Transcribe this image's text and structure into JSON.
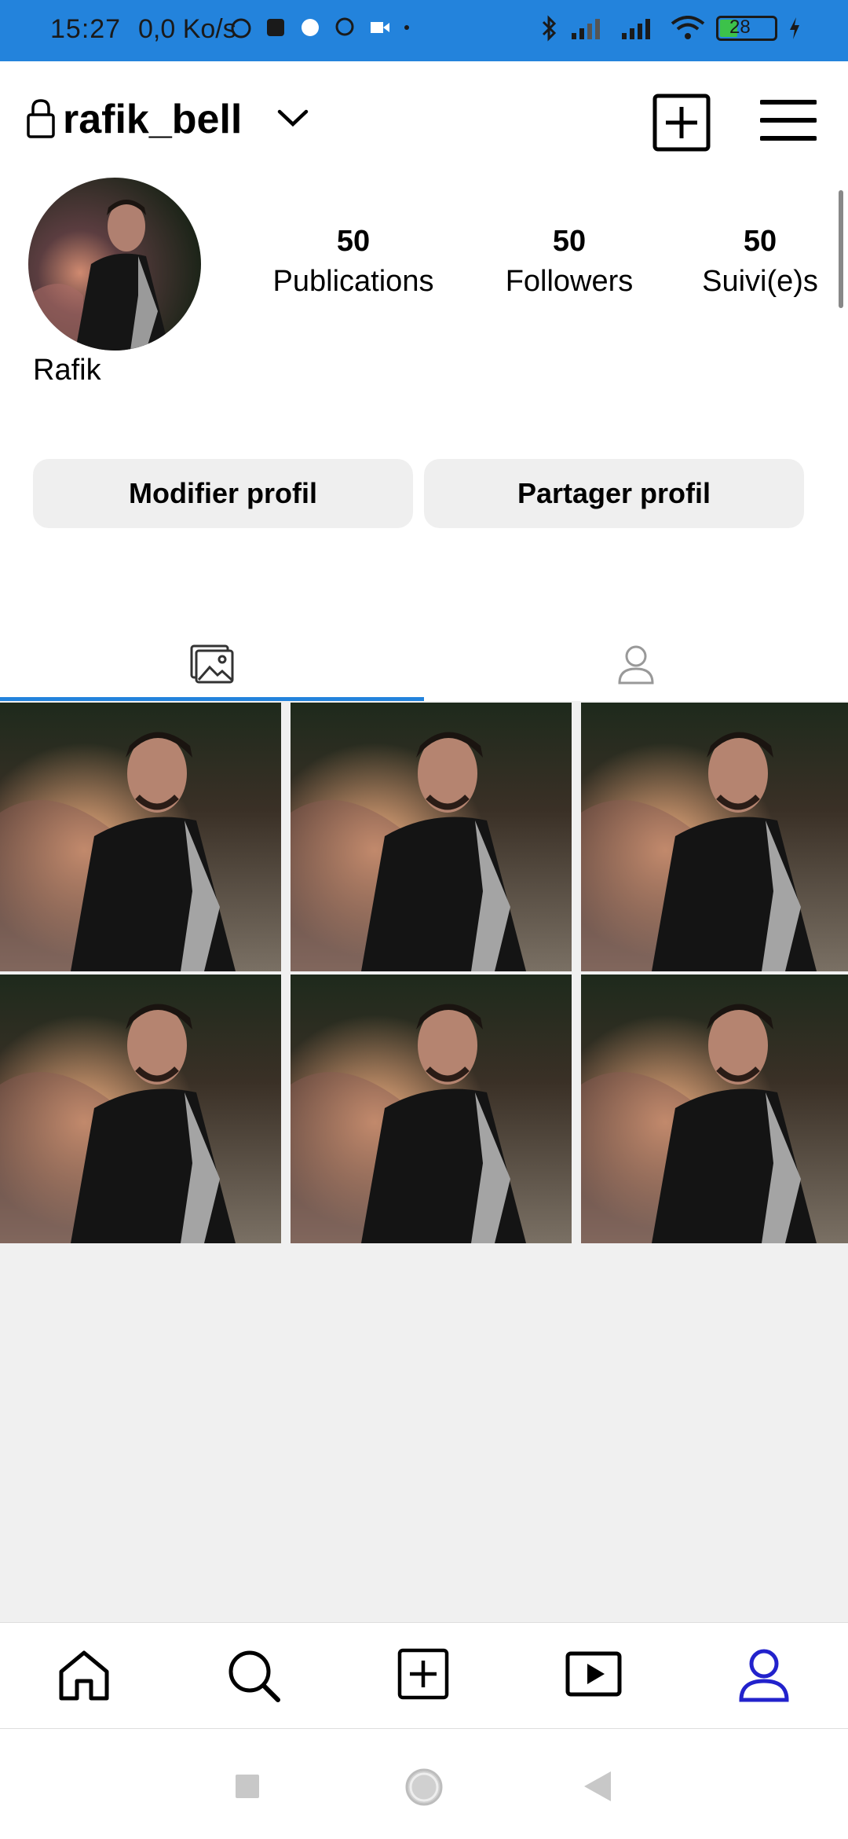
{
  "status_bar": {
    "time": "15:27",
    "net_speed": "0,0 Ko/s",
    "battery_level": "28",
    "accent_color": "#2383dc"
  },
  "header": {
    "username": "rafik_bell",
    "icons": [
      "lock-icon",
      "chevron-down-icon",
      "new-post-icon",
      "hamburger-menu-icon"
    ]
  },
  "profile": {
    "display_name": "Rafik",
    "stats": [
      {
        "value": "50",
        "label": "Publications"
      },
      {
        "value": "50",
        "label": "Followers"
      },
      {
        "value": "50",
        "label": "Suivi(e)s"
      }
    ],
    "edit_button": "Modifier profil",
    "share_button": "Partager profil"
  },
  "tabs": {
    "active": "posts",
    "items": [
      "posts-grid-icon",
      "tagged-user-icon"
    ]
  },
  "posts": {
    "count_shown": 6
  },
  "bottom_nav": {
    "items": [
      "home-icon",
      "search-icon",
      "create-icon",
      "reels-icon",
      "profile-icon"
    ],
    "active": "profile-icon",
    "active_color": "#2222cc"
  },
  "system_nav": {
    "items": [
      "recents-square-icon",
      "home-circle-icon",
      "back-triangle-icon"
    ]
  }
}
